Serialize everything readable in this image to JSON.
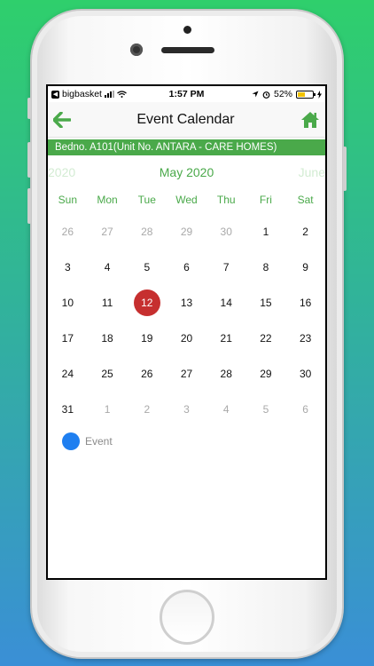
{
  "status_bar": {
    "carrier": "bigbasket",
    "time": "1:57 PM",
    "battery": "52%",
    "battery_level": 0.52
  },
  "navbar": {
    "title": "Event Calendar",
    "back_icon": "arrow-left-icon",
    "home_icon": "home-icon",
    "accent": "#4aa94a"
  },
  "banner": {
    "text": "Bedno. A101(Unit No. ANTARA - CARE HOMES)"
  },
  "calendar": {
    "prev_month": "2020",
    "current_month": "May 2020",
    "next_month": "June",
    "weekdays": [
      "Sun",
      "Mon",
      "Tue",
      "Wed",
      "Thu",
      "Fri",
      "Sat"
    ],
    "weeks": [
      [
        "26",
        "27",
        "28",
        "29",
        "30",
        "1",
        "2"
      ],
      [
        "3",
        "4",
        "5",
        "6",
        "7",
        "8",
        "9"
      ],
      [
        "10",
        "11",
        "12",
        "13",
        "14",
        "15",
        "16"
      ],
      [
        "17",
        "18",
        "19",
        "20",
        "21",
        "22",
        "23"
      ],
      [
        "24",
        "25",
        "26",
        "27",
        "28",
        "29",
        "30"
      ],
      [
        "31",
        "1",
        "2",
        "3",
        "4",
        "5",
        "6"
      ]
    ],
    "today_color": "#c62f2f"
  },
  "legend": {
    "label": "Event",
    "color": "#1f7ff0"
  }
}
